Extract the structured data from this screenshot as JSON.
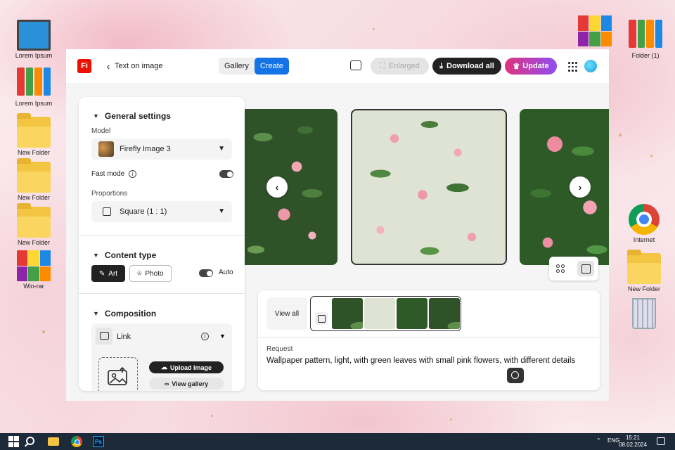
{
  "desktop": {
    "icons_left": [
      {
        "label": "Lorem Ipsum",
        "icon": "computer-icon"
      },
      {
        "label": "Lorem Ipsum",
        "icon": "binders-icon"
      },
      {
        "label": "New Folder",
        "icon": "folder-icon"
      },
      {
        "label": "New Folder",
        "icon": "folder-icon"
      },
      {
        "label": "New Folder",
        "icon": "folder-icon"
      },
      {
        "label": "Win-rar",
        "icon": "winrar-icon"
      }
    ],
    "icons_right": [
      {
        "label": "",
        "icon": "winrar-icon"
      },
      {
        "label": "Folder (1)",
        "icon": "binders-icon"
      },
      {
        "label": "Internet",
        "icon": "chrome-icon"
      },
      {
        "label": "New Folder",
        "icon": "folder-icon"
      },
      {
        "label": "",
        "icon": "recycle-bin-icon"
      }
    ]
  },
  "app": {
    "logo": "Fi",
    "breadcrumb": "Text on image",
    "tabs": {
      "gallery": "Gallery",
      "create": "Create"
    },
    "buttons": {
      "enlarged": "Enlarged",
      "download_all": "Download all",
      "update": "Update"
    },
    "colors": {
      "accent": "#1473e6",
      "logo": "#eb1000",
      "update_start": "#e0337f",
      "update_end": "#8e4ef2"
    }
  },
  "panel": {
    "general_settings": "General settings",
    "model_label": "Model",
    "model_value": "Firefly Image 3",
    "fast_mode_label": "Fast mode",
    "fast_mode_on": true,
    "proportions_label": "Proportions",
    "proportions_value": "Square (1 : 1)",
    "content_type": "Content type",
    "art_label": "Art",
    "photo_label": "Photo",
    "auto_label": "Auto",
    "composition": "Composition",
    "link_label": "Link",
    "upload_image": "Upload Image",
    "view_gallery": "View gallery"
  },
  "results": {
    "view_all": "View all",
    "request_label": "Request",
    "request_text": "Wallpaper pattern, light, with green leaves with small pink flowers, with different details"
  },
  "taskbar": {
    "tray_lang": "ENG",
    "time": "15:21",
    "date": "08.02.2024"
  }
}
